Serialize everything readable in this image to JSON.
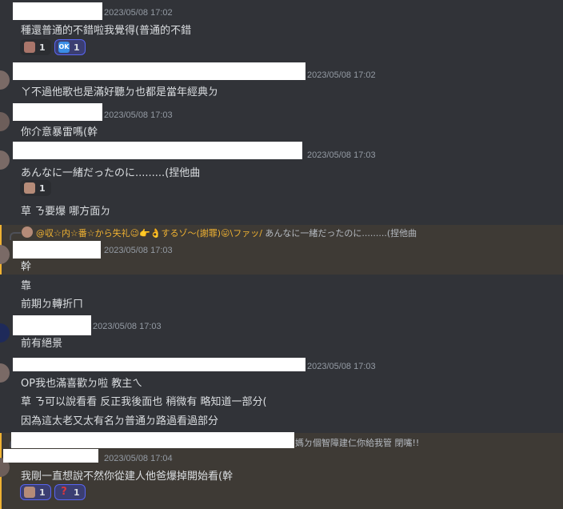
{
  "messages": [
    {
      "time": "2023/05/08 17:02",
      "lines": [
        "種還普通的不錯啦我覺得(普通的不錯"
      ],
      "reactions": [
        {
          "icon": "face-emoji-icon",
          "count": "1"
        },
        {
          "icon": "ok-emoji-icon",
          "count": "1"
        }
      ]
    },
    {
      "time": "2023/05/08 17:02",
      "lines": [
        "ㄚ不過他歌也是滿好聽ㄉ也都是當年經典ㄉ"
      ]
    },
    {
      "time": "2023/05/08 17:03",
      "lines": [
        "你介意暴雷嗎(幹"
      ]
    },
    {
      "time": "2023/05/08 17:03",
      "lines": [
        "あんなに一緒だったのに.........(捏他曲",
        "草 ㄋ要爆 哪方面ㄉ"
      ],
      "reactions": [
        {
          "icon": "person-emoji-icon",
          "count": "1"
        }
      ]
    },
    {
      "reply": {
        "mention": "@収☆内☆番☆から失礼😉👉👌するゾ〜(謝罪)😛\\ファッ/",
        "text": "あんなに一緒だったのに.........(捏他曲"
      },
      "time": "2023/05/08 17:03",
      "lines": [
        "幹",
        "靠",
        "前期ㄉ轉折ㄇ"
      ]
    },
    {
      "time": "2023/05/08 17:03",
      "lines": [
        "前有絕景"
      ]
    },
    {
      "time": "2023/05/08 17:03",
      "lines": [
        "OP我也滿喜歡ㄉ啦 教主ㄟ",
        "草 ㄋ可以說看看 反正我後面也 稍微有 略知道一部分(",
        "因為這太老又太有名ㄉ普通ㄉ路過看過部分"
      ]
    },
    {
      "reply": {
        "text": "媽ㄉ個智障建仁你給我管 閉嘴!!"
      },
      "time": "2023/05/08 17:04",
      "lines": [
        "我剛一直想說不然你從建人他爸爆掉開始看(幹"
      ],
      "reactions": [
        {
          "icon": "person-emoji-icon",
          "count": "1"
        },
        {
          "icon": "question-emoji-icon",
          "count": "1"
        }
      ]
    }
  ],
  "colors": {
    "background": "#313338",
    "text": "#dbdee1",
    "muted": "#949ba4",
    "highlight": "#3e3a35",
    "mention": "#f0b232",
    "accent": "#5865f2"
  }
}
